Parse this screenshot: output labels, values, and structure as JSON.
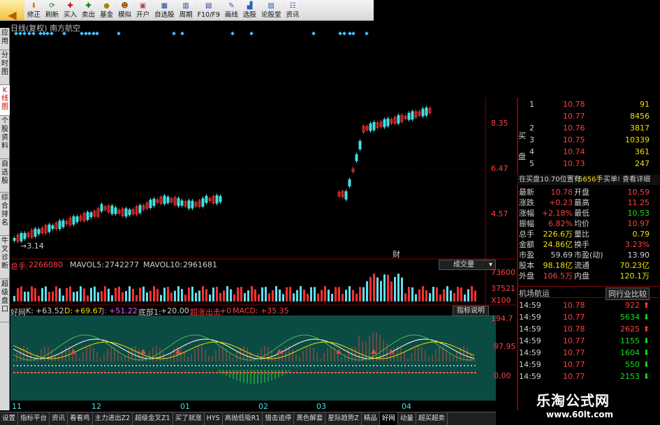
{
  "toolbar": {
    "items": [
      "修正",
      "刷新",
      "买入",
      "卖出",
      "基金",
      "模拟",
      "开户",
      "自选股",
      "周期",
      "F10/F9",
      "画线",
      "选股",
      "论股堂",
      "资讯"
    ]
  },
  "side_tabs": [
    "应用",
    "分时图",
    "K线图",
    "个股资料",
    "自选股",
    "综合排名",
    "牛叉诊断",
    "超级盘口"
  ],
  "chart": {
    "title": "日线(复权) 南方航空",
    "price_axis": [
      "8.35",
      "6.47",
      "4.57"
    ],
    "low_label": "3.14",
    "fin_marker": "财",
    "month_labels": [
      "11",
      "12",
      "01",
      "02",
      "03",
      "04"
    ]
  },
  "volume": {
    "total_label": "总手:",
    "total_value": "2266080",
    "mavol5_label": "MAVOL5:",
    "mavol5": "2742277",
    "mavol10_label": "MAVOL10:",
    "mavol10": "2961681",
    "dropdown": "成交量",
    "axis": [
      "73600",
      "37521",
      "X100"
    ]
  },
  "indicator": {
    "name": "好网",
    "k_label": "K:",
    "k": "+63.52",
    "d_label": "D:",
    "d": "+69.67",
    "j_label": "J:",
    "j": "+51.22",
    "db_label": "底部1:",
    "db": "+20.00",
    "zt_label": "超涨出击:",
    "zt": "+0",
    "macd_label": "MACD:",
    "macd": "+35.35",
    "btn": "指标说明",
    "axis": [
      "194.7",
      "97.95",
      "0.00"
    ]
  },
  "orderbook": {
    "asks": [
      {
        "n": "1",
        "p": "10.78",
        "v": "91"
      },
      {
        "n": "",
        "p": "10.77",
        "v": "8456"
      },
      {
        "n": "2",
        "p": "10.76",
        "v": "3817"
      },
      {
        "n": "3",
        "p": "10.75",
        "v": "10339"
      },
      {
        "n": "4",
        "p": "10.74",
        "v": "361"
      },
      {
        "n": "5",
        "p": "10.73",
        "v": "247"
      }
    ],
    "side_buy": "买",
    "side_pan": "盘",
    "note1": "在买盘10.70位置有",
    "note2": "5656手",
    "note3": "买单! 查看详细"
  },
  "quote": [
    [
      "最新",
      "10.78",
      "开盘",
      "10.59"
    ],
    [
      "涨跌",
      "+0.23",
      "最高",
      "11.25"
    ],
    [
      "涨幅",
      "+2.18%",
      "最低",
      "10.53"
    ],
    [
      "振幅",
      "6.82%",
      "均价",
      "10.97"
    ],
    [
      "总手",
      "226.6万",
      "量比",
      "0.79"
    ],
    [
      "金额",
      "24.86亿",
      "换手",
      "3.23%"
    ],
    [
      "市盈",
      "59.69",
      "市盈(动)",
      "13.90"
    ],
    [
      "股本",
      "98.18亿",
      "流通",
      "70.23亿"
    ],
    [
      "外盘",
      "106.5万",
      "内盘",
      "120.1万"
    ]
  ],
  "industry": {
    "name": "机场航运",
    "btn": "同行业比较"
  },
  "ticks": [
    [
      "14:59",
      "10.78",
      "922"
    ],
    [
      "14:59",
      "10.77",
      "5634"
    ],
    [
      "14:59",
      "10.78",
      "2625"
    ],
    [
      "14:59",
      "10.77",
      "1155"
    ],
    [
      "14:59",
      "10.77",
      "1604"
    ],
    [
      "14:59",
      "10.77",
      "550"
    ],
    [
      "14:59",
      "10.77",
      "2153"
    ]
  ],
  "bottom_tabs": [
    "设置",
    "指标平台",
    "资讯",
    "看看鸡",
    "主力进出Z2",
    "超级金叉Z1",
    "买了就涨",
    "HYS",
    "高抛低吸R1",
    "猎击追停",
    "黑色解套",
    "星际趋势Z",
    "精品",
    "好网",
    "动量",
    "超买超卖"
  ],
  "watermark": {
    "text": "乐淘公式网",
    "url": "www.60lt.com"
  }
}
